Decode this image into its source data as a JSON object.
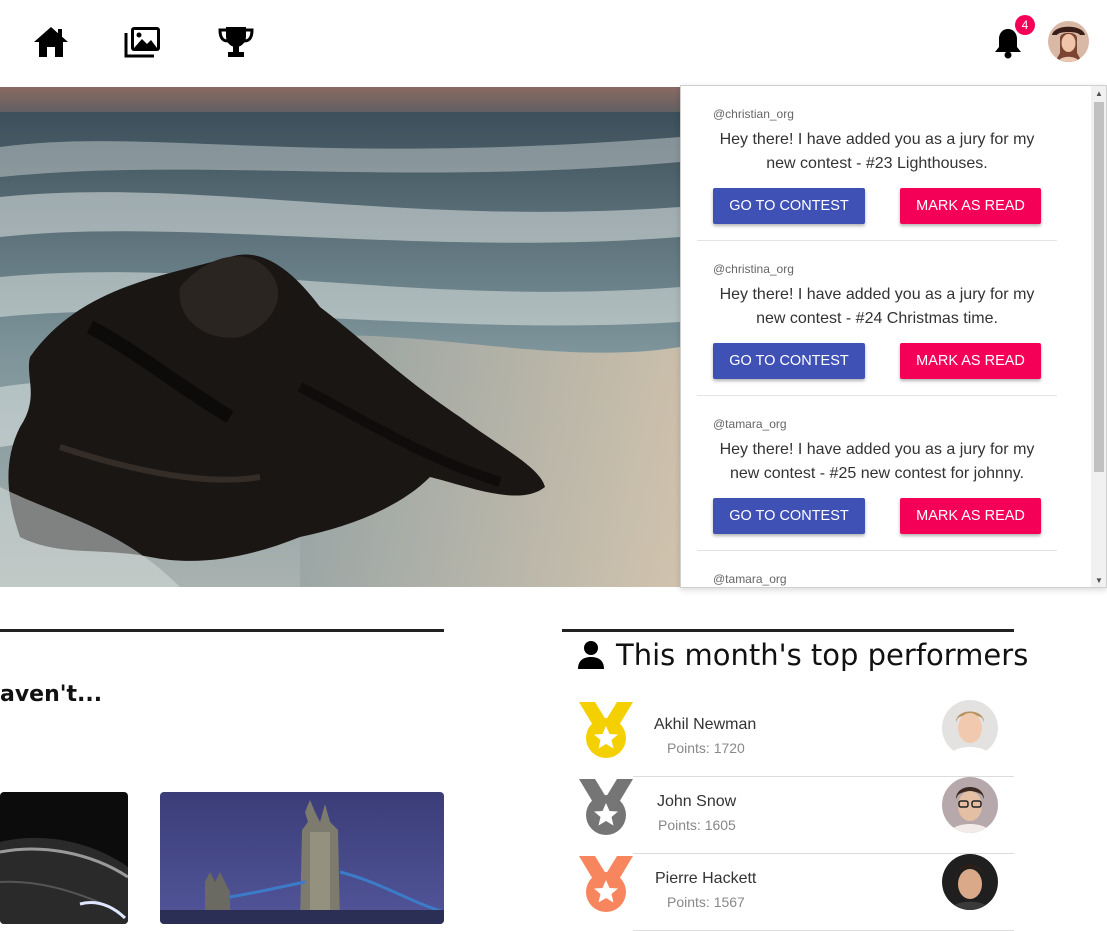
{
  "nav": {
    "icons": [
      "home-icon",
      "gallery-icon",
      "trophy-icon"
    ],
    "notification_count": "4",
    "bell_icon": "bell-icon"
  },
  "notifications": [
    {
      "user": "@christian_org",
      "message": "Hey there! I have added you as a jury for my new contest - #23 Lighthouses.",
      "go_label": "GO TO CONTEST",
      "read_label": "MARK AS READ"
    },
    {
      "user": "@christina_org",
      "message": "Hey there! I have added you as a jury for my new contest - #24 Christmas time.",
      "go_label": "GO TO CONTEST",
      "read_label": "MARK AS READ"
    },
    {
      "user": "@tamara_org",
      "message": "Hey there! I have added you as a jury for my new contest - #25 new contest for johnny.",
      "go_label": "GO TO CONTEST",
      "read_label": "MARK AS READ"
    },
    {
      "user": "@tamara_org"
    }
  ],
  "left_section": {
    "partial_title": "aven't..."
  },
  "performers": {
    "title": "This month's top performers",
    "items": [
      {
        "name": "Akhil Newman",
        "points": "Points: 1720",
        "medal": "gold"
      },
      {
        "name": "John Snow",
        "points": "Points: 1605",
        "medal": "silver"
      },
      {
        "name": "Pierre Hackett",
        "points": "Points: 1567",
        "medal": "bronze"
      }
    ]
  },
  "colors": {
    "primary": "#3f51b5",
    "accent": "#f50057",
    "gold": "#f5d000",
    "silver": "#757575",
    "bronze": "#f7865f"
  }
}
